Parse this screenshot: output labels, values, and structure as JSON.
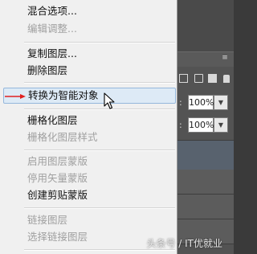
{
  "context_menu": {
    "items": [
      {
        "label": "混合选项...",
        "enabled": true
      },
      {
        "label": "编辑调整...",
        "enabled": false
      },
      {
        "label": "复制图层...",
        "enabled": true
      },
      {
        "label": "删除图层",
        "enabled": true
      },
      {
        "label": "转换为智能对象",
        "enabled": true,
        "highlighted": true
      },
      {
        "label": "栅格化图层",
        "enabled": true
      },
      {
        "label": "栅格化图层样式",
        "enabled": false
      },
      {
        "label": "启用图层蒙版",
        "enabled": false
      },
      {
        "label": "停用矢量蒙版",
        "enabled": false
      },
      {
        "label": "创建剪贴蒙版",
        "enabled": true
      },
      {
        "label": "链接图层",
        "enabled": false
      },
      {
        "label": "选择链接图层",
        "enabled": false
      }
    ]
  },
  "layers_panel": {
    "opacity_value": "100%",
    "fill_value": "100%"
  },
  "watermark": {
    "text": "头条号 / IT优就业"
  },
  "colors": {
    "menu_bg": "#f0f0f0",
    "highlight_bg": "#ddeaf6",
    "highlight_border": "#95b7db",
    "disabled_text": "#a0a0a0",
    "arrow_red": "#e02020",
    "panel_bg": "#535353"
  }
}
